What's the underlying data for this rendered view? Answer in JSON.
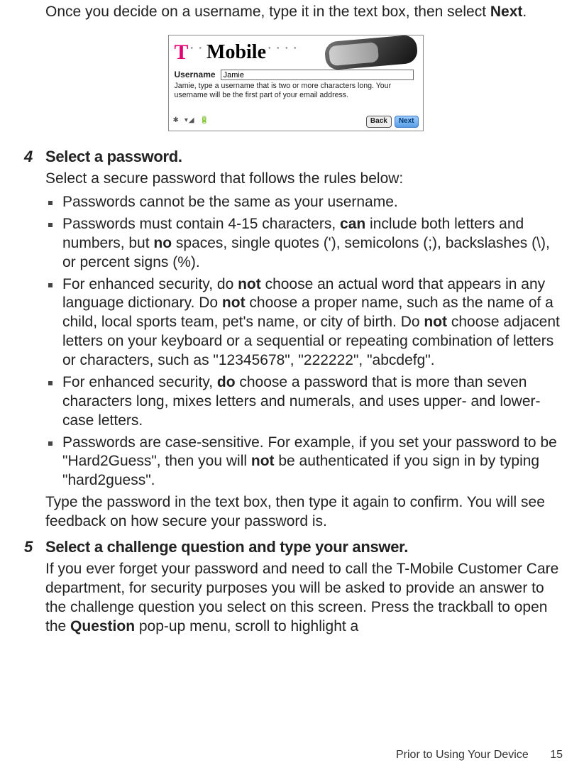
{
  "intro": {
    "pre": "Once you decide on a username, type it in the text box, then select ",
    "bold": "Next",
    "post": "."
  },
  "screenshot": {
    "brand_t": "T",
    "brand_name": "Mobile",
    "username_label": "Username",
    "username_value": "Jamie",
    "hint": "Jamie, type a username that is two or more characters long. Your username will be the first part of your email address.",
    "back": "Back",
    "next": "Next"
  },
  "step4": {
    "num": "4",
    "title": "Select a password.",
    "lead": "Select a secure password that follows the rules below:",
    "rules": {
      "r0": "Passwords cannot be the same as your username.",
      "r1a": "Passwords must contain 4-15 characters, ",
      "r1b": "can",
      "r1c": " include both letters and numbers, but ",
      "r1d": "no",
      "r1e": " spaces, single quotes ('), semicolons (;), backslashes (\\), or percent signs (%).",
      "r2a": "For enhanced security, do ",
      "r2b": "not",
      "r2c": " choose an actual word that appears in any language dictionary. Do ",
      "r2d": "not",
      "r2e": " choose a proper name, such as the name of a child, local sports team, pet's name, or city of birth. Do ",
      "r2f": "not",
      "r2g": " choose adjacent letters on your keyboard or a sequential or repeating combination of letters or characters, such as \"12345678\", \"222222\", \"abcdefg\".",
      "r3a": "For enhanced security, ",
      "r3b": "do",
      "r3c": " choose a password that is more than seven characters long, mixes letters and numerals, and uses upper- and lower-case letters.",
      "r4a": "Passwords are case-sensitive. For example, if you set your password to be \"Hard2Guess\", then you will ",
      "r4b": "not",
      "r4c": " be authenticated if you sign in by typing \"hard2guess\"."
    },
    "tail": "Type the password in the text box, then type it again to confirm. You will see feedback on how secure your password is."
  },
  "step5": {
    "num": "5",
    "title": "Select a challenge question and type your answer.",
    "body_a": "If you ever forget your password and need to call the T-Mobile Customer Care department, for security purposes you will be asked to provide an answer to the challenge question you select on this screen. Press the trackball to open the ",
    "body_b": "Question",
    "body_c": " pop-up menu, scroll to highlight a"
  },
  "footer": {
    "section": "Prior to Using Your Device",
    "page": "15"
  }
}
